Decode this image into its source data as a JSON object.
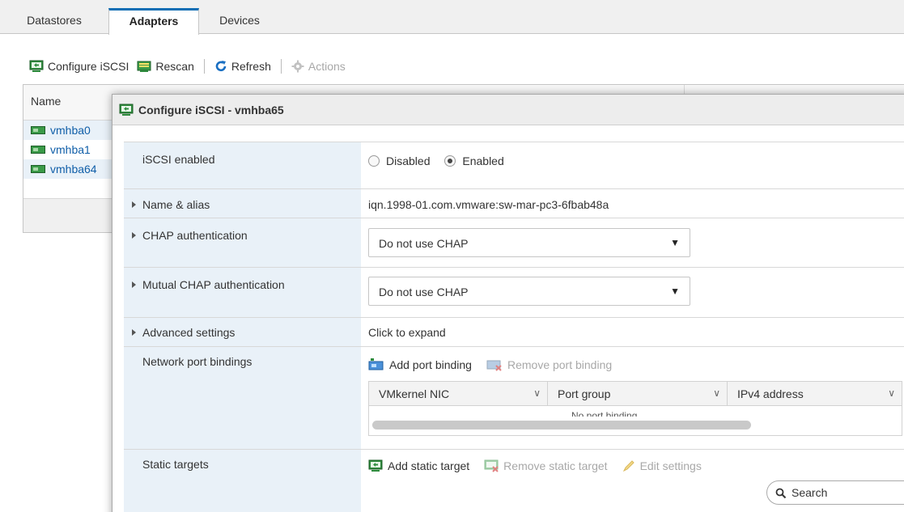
{
  "tabs": [
    {
      "label": "Datastores"
    },
    {
      "label": "Adapters",
      "active": true
    },
    {
      "label": "Devices"
    }
  ],
  "toolbar": {
    "configure_iscsi": "Configure iSCSI",
    "rescan": "Rescan",
    "refresh": "Refresh",
    "actions": "Actions"
  },
  "adapters_table": {
    "name_header": "Name",
    "rows": [
      {
        "name": "vmhba0"
      },
      {
        "name": "vmhba1"
      },
      {
        "name": "vmhba64"
      }
    ]
  },
  "dialog": {
    "title": "Configure iSCSI - vmhba65",
    "iscsi_enabled": {
      "label": "iSCSI enabled",
      "option_disabled": "Disabled",
      "option_enabled": "Enabled",
      "selected": "Enabled"
    },
    "name_alias": {
      "label": "Name & alias",
      "value": "iqn.1998-01.com.vmware:sw-mar-pc3-6fbab48a"
    },
    "chap": {
      "label": "CHAP authentication",
      "value": "Do not use CHAP"
    },
    "mutual_chap": {
      "label": "Mutual CHAP authentication",
      "value": "Do not use CHAP"
    },
    "advanced": {
      "label": "Advanced settings",
      "value": "Click to expand"
    },
    "port_bindings": {
      "label": "Network port bindings",
      "add": "Add port binding",
      "remove": "Remove port binding",
      "columns": [
        "VMkernel NIC",
        "Port group",
        "IPv4 address"
      ],
      "empty_text": "No port binding"
    },
    "static_targets": {
      "label": "Static targets",
      "add": "Add static target",
      "remove": "Remove static target",
      "edit": "Edit settings",
      "search_placeholder": "Search"
    }
  },
  "colors": {
    "accent": "#0f6eb4",
    "label_bg": "#e9f1f8",
    "link": "#0f5ea8"
  }
}
